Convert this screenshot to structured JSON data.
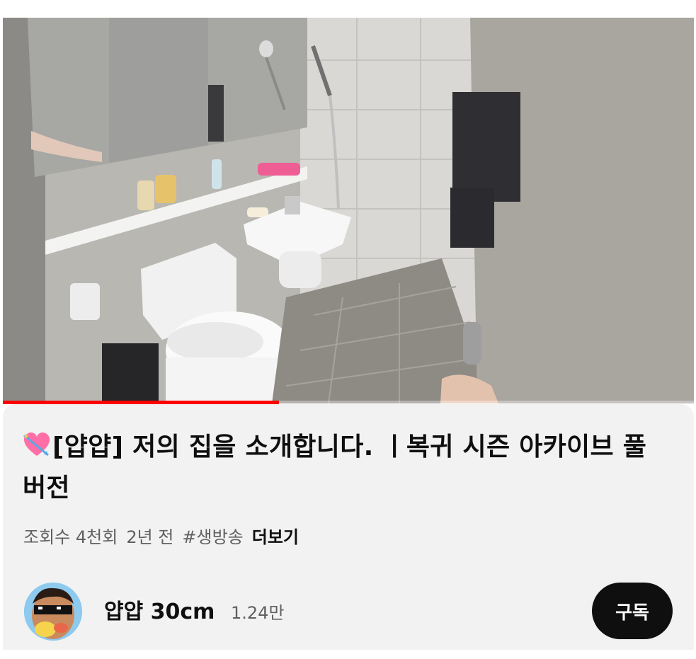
{
  "player": {
    "progress_fraction": 0.4,
    "progress_color": "#ff0000"
  },
  "video": {
    "title_emoji": "heart-with-arrow-icon",
    "title": "[얍얍] 저의 집을 소개합니다. ㅣ복귀 시즌 아카이브 풀버전",
    "views": "조회수 4천회",
    "age": "2년 전",
    "hashtag": "#생방송",
    "more_label": "더보기"
  },
  "channel": {
    "name": "얍얍 30cm",
    "subscribers": "1.24만",
    "subscribe_label": "구독",
    "avatar_icon": "sunglasses-avatar"
  }
}
